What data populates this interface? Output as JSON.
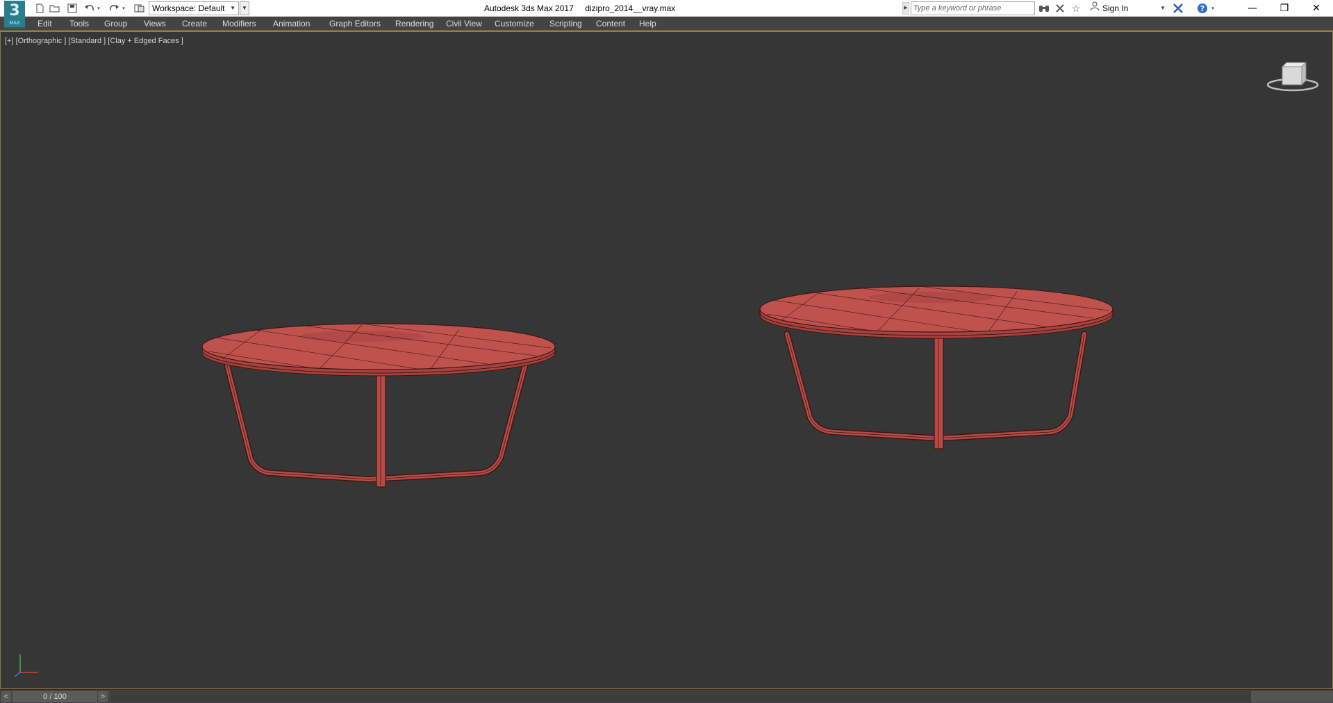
{
  "app": {
    "logo_text": "3",
    "logo_sub": "MAX",
    "window_title": "Autodesk 3ds Max 2017     dizipro_2014__vray.max"
  },
  "toolbar": {
    "workspace_label": "Workspace: Default",
    "search_placeholder": "Type a keyword or phrase",
    "sign_in_label": "Sign In",
    "icons": [
      "new-file-icon",
      "open-folder-icon",
      "save-icon",
      "undo-icon",
      "redo-icon",
      "project-icon",
      "binoculars-icon",
      "exchange-icon",
      "favorites-star-icon",
      "user-icon",
      "autodesk-x-icon",
      "help-icon"
    ]
  },
  "window_controls": {
    "minimize": "—",
    "restore": "❐",
    "close": "✕"
  },
  "menu": {
    "items": [
      "Edit",
      "Tools",
      "Group",
      "Views",
      "Create",
      "Modifiers",
      "Animation",
      "Graph Editors",
      "Rendering",
      "Civil View",
      "Customize",
      "Scripting",
      "Content",
      "Help"
    ]
  },
  "viewport": {
    "label": "[+] [Orthographic ] [Standard ] [Clay + Edged Faces ]",
    "background": "#363636",
    "object_color": "#c0524d",
    "edge_color": "#3a1715",
    "objects": [
      "round-table-left",
      "round-table-right"
    ]
  },
  "timeline": {
    "prev_label": "<",
    "frame_readout": "0 / 100",
    "next_label": ">"
  }
}
